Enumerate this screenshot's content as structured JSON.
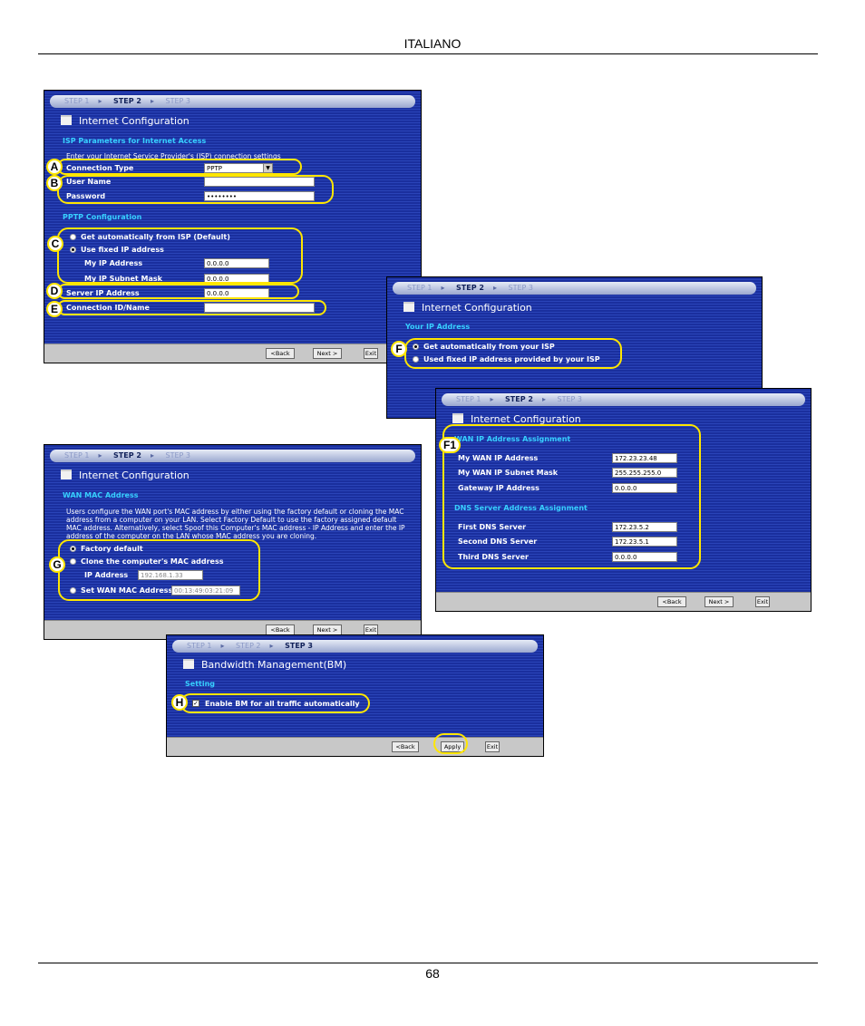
{
  "page": {
    "header": "ITALIANO",
    "page_number": "68"
  },
  "steps": {
    "step1": "STEP 1",
    "step2": "STEP 2",
    "step3": "STEP 3"
  },
  "buttons": {
    "back": "<Back",
    "next": "Next >",
    "exit": "Exit",
    "apply": "Apply"
  },
  "shot1": {
    "title": "Internet Configuration",
    "section_isp": "ISP Parameters for Internet Access",
    "intro": "Enter your Internet Service Provider's (ISP) connection settings",
    "connection_type_label": "Connection Type",
    "connection_type_value": "PPTP",
    "user_name_label": "User Name",
    "user_name_value": "",
    "password_label": "Password",
    "password_value": "••••••••",
    "section_pptp": "PPTP Configuration",
    "get_auto_label": "Get automatically from ISP (Default)",
    "use_fixed_label": "Use fixed IP address",
    "my_ip_label": "My IP Address",
    "my_ip_value": "0.0.0.0",
    "my_mask_label": "My IP Subnet Mask",
    "my_mask_value": "0.0.0.0",
    "server_ip_label": "Server IP Address",
    "server_ip_value": "0.0.0.0",
    "conn_id_label": "Connection ID/Name",
    "conn_id_value": ""
  },
  "shot2": {
    "title": "Internet Configuration",
    "section": "Your IP Address",
    "get_auto_label": "Get automatically from your ISP",
    "use_fixed_label": "Used fixed IP address provided by your ISP"
  },
  "shot3": {
    "title": "Internet Configuration",
    "section_wan": "WAN IP Address Assignment",
    "wan_ip_label": "My WAN IP Address",
    "wan_ip_value": "172.23.23.48",
    "wan_mask_label": "My WAN IP Subnet Mask",
    "wan_mask_value": "255.255.255.0",
    "gateway_label": "Gateway IP Address",
    "gateway_value": "0.0.0.0",
    "section_dns": "DNS Server Address Assignment",
    "dns1_label": "First DNS Server",
    "dns1_value": "172.23.5.2",
    "dns2_label": "Second DNS Server",
    "dns2_value": "172.23.5.1",
    "dns3_label": "Third DNS Server",
    "dns3_value": "0.0.0.0"
  },
  "shot4": {
    "title": "Internet Configuration",
    "section": "WAN MAC Address",
    "description": "Users configure the WAN port's MAC address by either using the factory default or cloning the MAC address from a computer on your LAN. Select Factory Default to use the factory assigned default MAC address. Alternatively, select Spoof this Computer's MAC address - IP Address and enter the IP address of the computer on the LAN whose MAC address you are cloning.",
    "factory_label": "Factory default",
    "clone_label": "Clone the computer's MAC address",
    "ip_label": "IP Address",
    "ip_value": "192.168.1.33",
    "set_mac_label": "Set WAN MAC Address",
    "mac_value": "00:13:49:03:21:09"
  },
  "shot5": {
    "title": "Bandwidth Management(BM)",
    "section": "Setting",
    "enable_label": "Enable BM for all traffic automatically"
  },
  "badges": {
    "a": "A",
    "b": "B",
    "c": "C",
    "d": "D",
    "e": "E",
    "f": "F",
    "f1": "F1",
    "g": "G",
    "h": "H"
  },
  "colors": {
    "panel_blue": "#1a2f9e",
    "section_cyan": "#37d0ff",
    "highlight_yellow": "#ffe600"
  }
}
